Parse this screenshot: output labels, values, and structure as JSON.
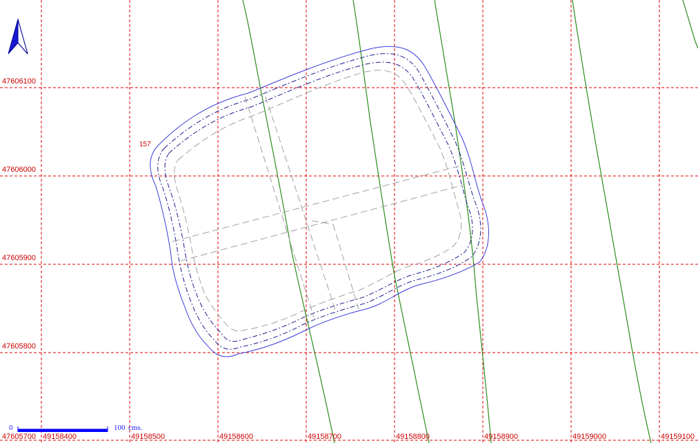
{
  "map": {
    "north_arrow_icon": "north-arrow-icon",
    "spot_elevation": "157",
    "grid_x_labels": [
      "47605700",
      "49158400",
      "49158500",
      "49158600",
      "49158700",
      "49158800",
      "49158900",
      "49159000",
      "49159100"
    ],
    "grid_y_labels": [
      "47606100",
      "47606000",
      "47605900",
      "47605800"
    ],
    "scale_bar": {
      "start_label": "0",
      "end_label": "100",
      "unit_label": "cms."
    },
    "colors": {
      "grid": "#e00000",
      "contour": "#2a8c1a",
      "outline": "#3a3adc",
      "dashed_outline": "#1c1c8c",
      "interior_lines": "#a0a0a0",
      "scale_bar": "#0000ff"
    }
  }
}
